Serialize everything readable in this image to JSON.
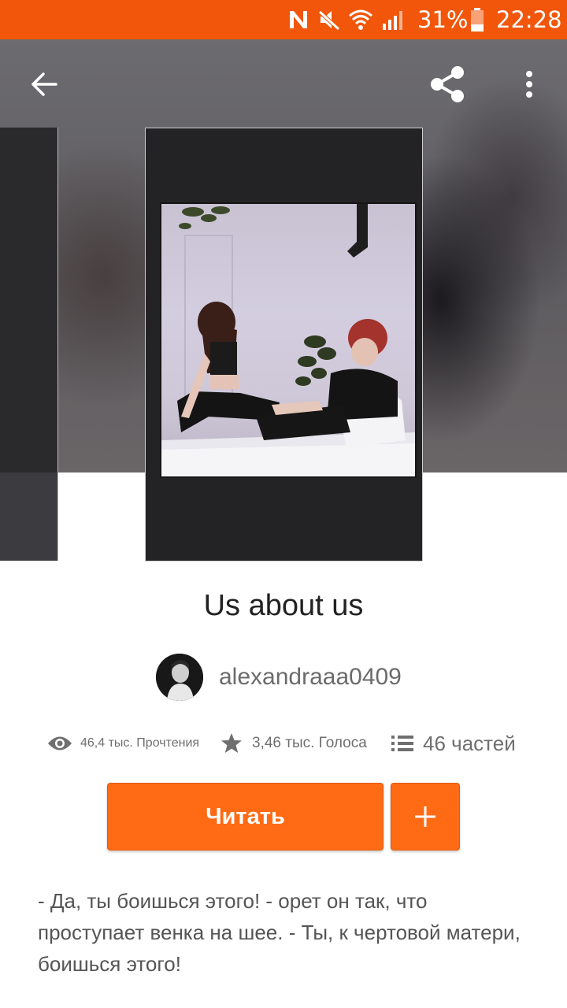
{
  "status_bar": {
    "battery_percent": "31%",
    "time": "22:28",
    "icons": [
      "n-icon",
      "mute-icon",
      "wifi-icon",
      "signal-icon",
      "battery-icon"
    ]
  },
  "header": {
    "icons": [
      "back-arrow-icon",
      "share-icon",
      "more-vertical-icon"
    ]
  },
  "story": {
    "title": "Us about us",
    "author": "alexandraaa0409",
    "stats": {
      "reads": "46,4 тыс. Прочтения",
      "votes": "3,46 тыс. Голоса",
      "parts": "46 частей"
    },
    "read_button": "Читать",
    "description": "- Да, ты боишься этого! - орет он так, что проступает венка на шее. - Ты, к чертовой матери, боишься этого!"
  },
  "colors": {
    "accent": "#ff6a14",
    "status_bar": "#f2560a",
    "title_text": "#222222",
    "secondary_text": "#6f6f6f"
  }
}
